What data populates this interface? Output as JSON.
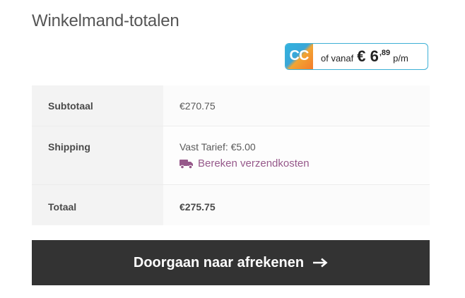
{
  "header": {
    "title": "Winkelmand-totalen"
  },
  "financing_badge": {
    "logo_text": "CC",
    "prefix": "of vanaf",
    "amount": "€ 6",
    "cents": ",89",
    "suffix": "p/m",
    "colors": {
      "border": "#3db0d6",
      "logo_blue": "#2fb3e0",
      "logo_orange": "#f47b2a"
    }
  },
  "totals": {
    "rows": [
      {
        "label": "Subtotaal",
        "value": "€270.75"
      },
      {
        "label": "Shipping",
        "value": "Vast Tarief: €5.00"
      },
      {
        "label": "Totaal",
        "value": "€275.75"
      }
    ],
    "shipping_calculator_label": "Bereken verzendkosten",
    "shipping_icon": "truck-icon",
    "link_color": "#96588a"
  },
  "checkout": {
    "button_label": "Doorgaan naar afrekenen",
    "icon": "arrow-right-icon",
    "background": "#333333"
  }
}
